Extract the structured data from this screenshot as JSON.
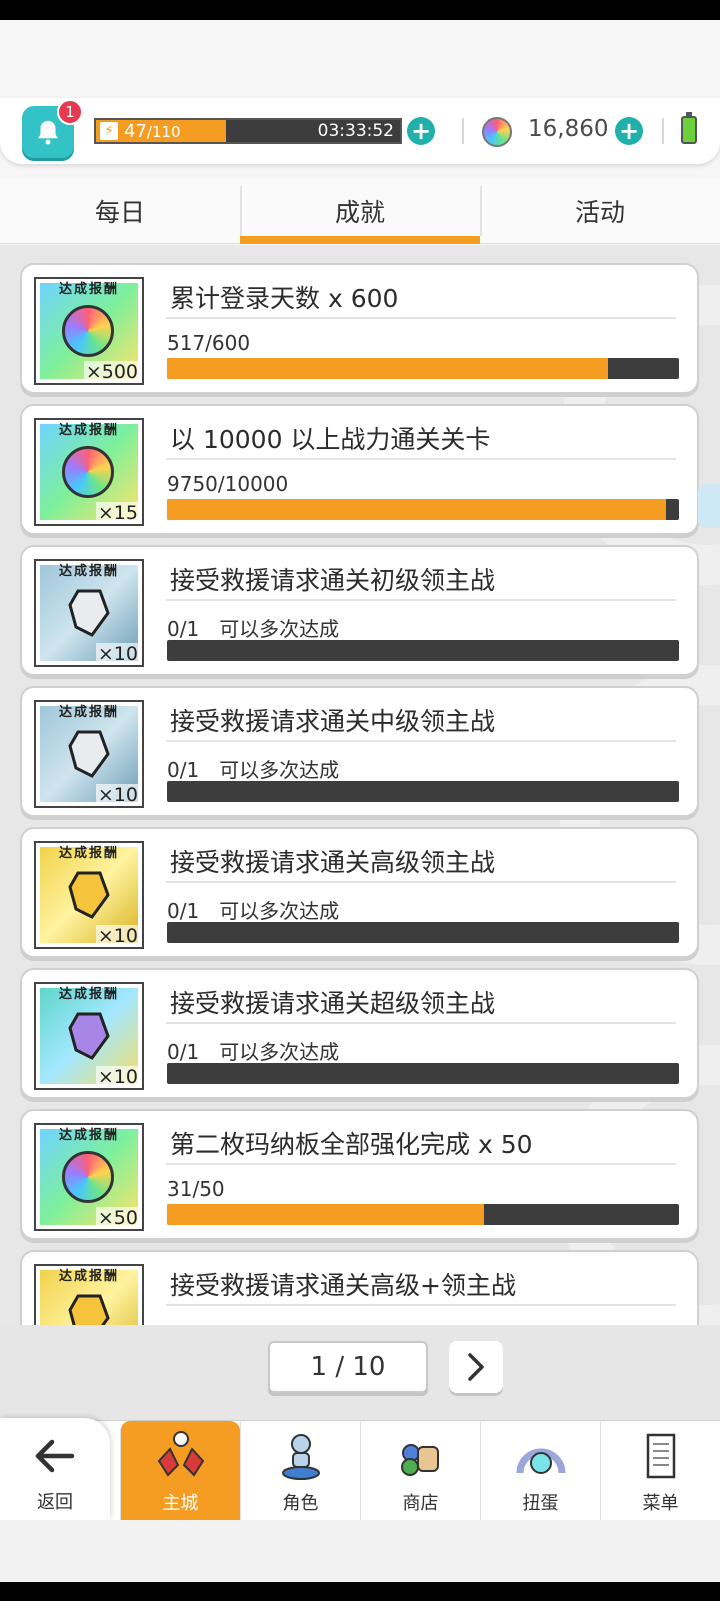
{
  "hud": {
    "notification_count": "1",
    "stamina": {
      "current": "47",
      "max": "/110",
      "fraction": 0.427,
      "timer": "03:33:52"
    },
    "gems": "16,860"
  },
  "tabs": [
    {
      "label": "每日"
    },
    {
      "label": "成就"
    },
    {
      "label": "活动"
    }
  ],
  "active_tab": 1,
  "achievements": [
    {
      "reward_label": "达成报酬",
      "reward_icon": "rainbow-orb-icon",
      "reward_qty": "×500",
      "title": "累计登录天数 x 600",
      "progress_text": "517/600",
      "note": "",
      "progress": 0.862
    },
    {
      "reward_label": "达成报酬",
      "reward_icon": "rainbow-orb-icon",
      "reward_qty": "×15",
      "title": "以 10000 以上战力通关关卡",
      "progress_text": "9750/10000",
      "note": "",
      "progress": 0.975
    },
    {
      "reward_label": "达成报酬",
      "reward_icon": "silver-crystal-icon",
      "reward_qty": "×10",
      "title": "接受救援请求通关初级领主战",
      "progress_text": "0/1",
      "note": "可以多次达成",
      "progress": 0
    },
    {
      "reward_label": "达成报酬",
      "reward_icon": "silver-crystal-icon",
      "reward_qty": "×10",
      "title": "接受救援请求通关中级领主战",
      "progress_text": "0/1",
      "note": "可以多次达成",
      "progress": 0
    },
    {
      "reward_label": "达成报酬",
      "reward_icon": "gold-crystal-icon",
      "reward_qty": "×10",
      "title": "接受救援请求通关高级领主战",
      "progress_text": "0/1",
      "note": "可以多次达成",
      "progress": 0
    },
    {
      "reward_label": "达成报酬",
      "reward_icon": "purple-crystal-icon",
      "reward_qty": "×10",
      "title": "接受救援请求通关超级领主战",
      "progress_text": "0/1",
      "note": "可以多次达成",
      "progress": 0
    },
    {
      "reward_label": "达成报酬",
      "reward_icon": "rainbow-orb-icon",
      "reward_qty": "×50",
      "title": "第二枚玛纳板全部强化完成 x 50",
      "progress_text": "31/50",
      "note": "",
      "progress": 0.62
    },
    {
      "reward_label": "达成报酬",
      "reward_icon": "gold-crystal-icon",
      "reward_qty": "",
      "title": "接受救援请求通关高级+领主战",
      "progress_text": "",
      "note": "",
      "progress": 0
    }
  ],
  "pager": {
    "text": "1 / 10"
  },
  "nav": {
    "back_label": "返回",
    "items": [
      {
        "label": "主城",
        "icon": "castle-icon"
      },
      {
        "label": "角色",
        "icon": "character-icon"
      },
      {
        "label": "商店",
        "icon": "shop-icon"
      },
      {
        "label": "扭蛋",
        "icon": "gacha-icon"
      },
      {
        "label": "菜单",
        "icon": "menu-icon"
      }
    ],
    "active_index": 0
  },
  "colors": {
    "accent": "#f59c23",
    "teal": "#33c3c7",
    "bar_bg": "#3d3d3d"
  }
}
